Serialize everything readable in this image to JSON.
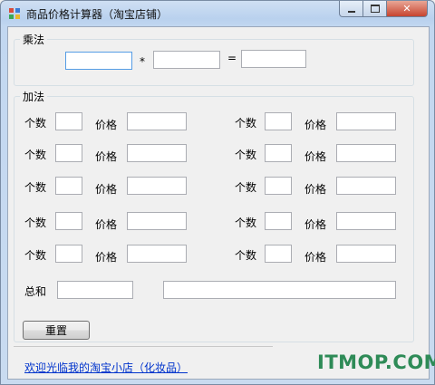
{
  "window": {
    "title": "商品价格计算器（淘宝店铺）"
  },
  "multiply": {
    "group_label": "乘法",
    "operator": "*",
    "equals": "=",
    "input_a": "",
    "input_b": "",
    "result": ""
  },
  "add": {
    "group_label": "加法",
    "qty_label": "个数",
    "price_label": "价格",
    "rows": [
      {
        "qty_left": "",
        "price_left": "",
        "qty_right": "",
        "price_right": ""
      },
      {
        "qty_left": "",
        "price_left": "",
        "qty_right": "",
        "price_right": ""
      },
      {
        "qty_left": "",
        "price_left": "",
        "qty_right": "",
        "price_right": ""
      },
      {
        "qty_left": "",
        "price_left": "",
        "qty_right": "",
        "price_right": ""
      },
      {
        "qty_left": "",
        "price_left": "",
        "qty_right": "",
        "price_right": ""
      }
    ],
    "total_label": "总和",
    "total_value": "",
    "total_detail": ""
  },
  "reset_button": "重置",
  "footer_link": "欢迎光临我的淘宝小店（化妆品）",
  "watermark": "ITMOP.COM"
}
